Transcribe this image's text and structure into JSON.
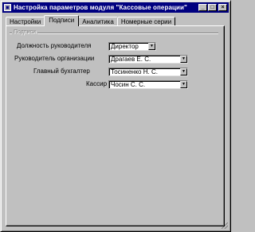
{
  "window": {
    "title": "Настройка параметров модуля \"Кассовые операции\"",
    "icon": "app-icon",
    "controls": [
      "minimize-button",
      "maximize-button",
      "close-button"
    ]
  },
  "tabs": [
    {
      "label": "Настройки",
      "active": false
    },
    {
      "label": "Подписи",
      "active": true
    },
    {
      "label": "Аналитика",
      "active": false
    },
    {
      "label": "Номерные серии",
      "active": false
    }
  ],
  "group": {
    "label": "Подписи"
  },
  "fields": [
    {
      "label": "Должность руководителя",
      "value": "Директор"
    },
    {
      "label": "Руководитель организации",
      "value": "Драгаев Е. С."
    },
    {
      "label": "Главный бухгалтер",
      "value": "Тосиненко Н. С."
    },
    {
      "label": "Кассир",
      "value": "Чосин С. С."
    }
  ],
  "colors": {
    "titlebar": "#000080",
    "face": "#c0c0c0"
  }
}
